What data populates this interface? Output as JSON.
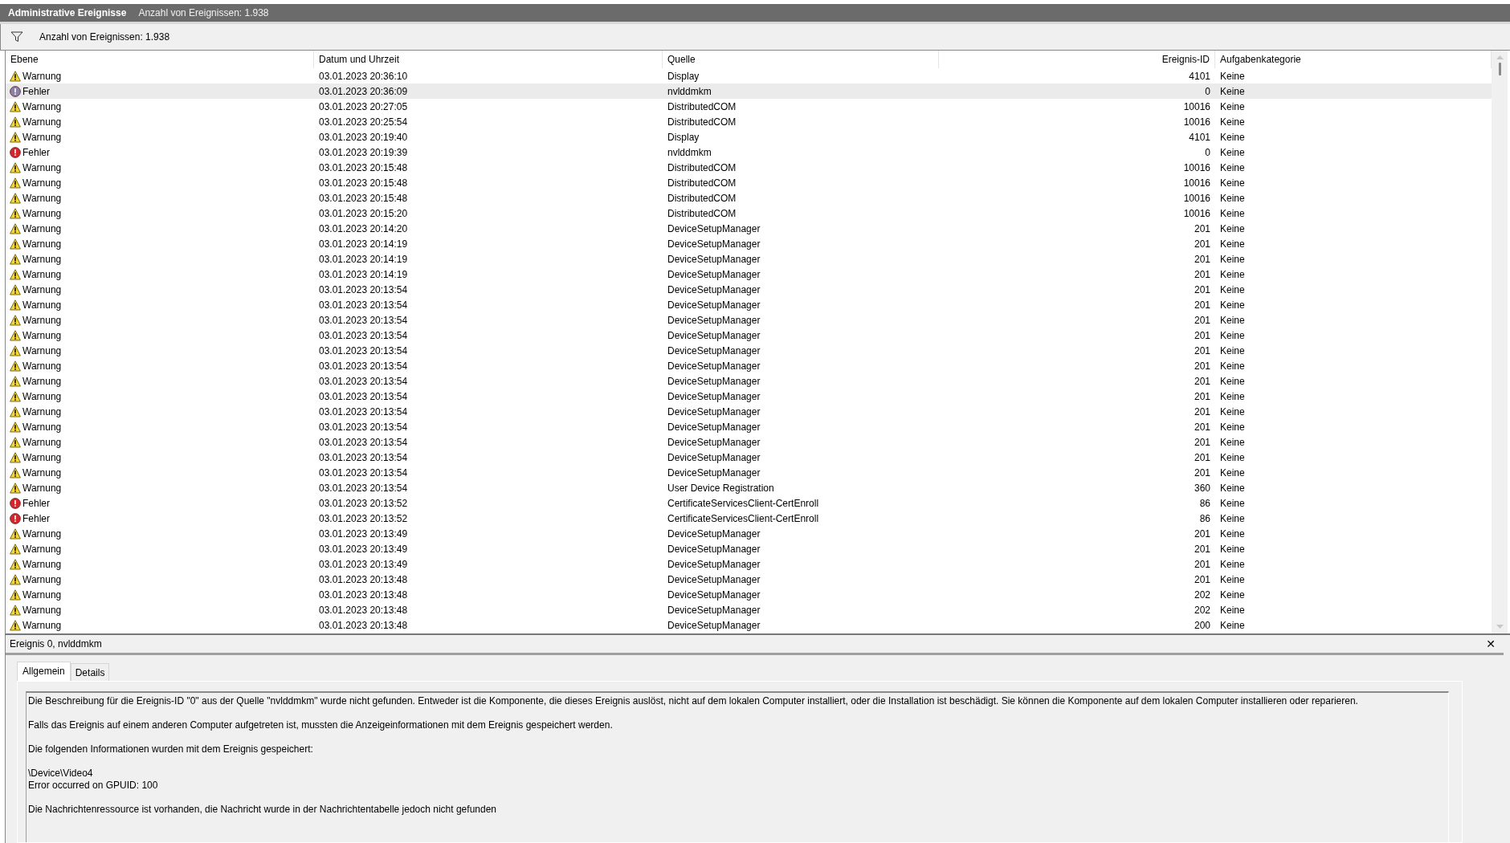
{
  "title_bar": {
    "title": "Administrative Ereignisse",
    "count": "Anzahl von Ereignissen: 1.938"
  },
  "filter_bar": {
    "text": "Anzahl von Ereignissen: 1.938"
  },
  "table": {
    "columns": [
      "Ebene",
      "Datum und Uhrzeit",
      "Quelle",
      "Ereignis-ID",
      "Aufgabenkategorie"
    ],
    "rows": [
      {
        "kind": "warning",
        "level": "Warnung",
        "datetime": "03.01.2023 20:36:10",
        "source": "Display",
        "event_id": "4101",
        "category": "Keine",
        "selected": false
      },
      {
        "kind": "error",
        "level": "Fehler",
        "datetime": "03.01.2023 20:36:09",
        "source": "nvlddmkm",
        "event_id": "0",
        "category": "Keine",
        "selected": true
      },
      {
        "kind": "warning",
        "level": "Warnung",
        "datetime": "03.01.2023 20:27:05",
        "source": "DistributedCOM",
        "event_id": "10016",
        "category": "Keine",
        "selected": false
      },
      {
        "kind": "warning",
        "level": "Warnung",
        "datetime": "03.01.2023 20:25:54",
        "source": "DistributedCOM",
        "event_id": "10016",
        "category": "Keine",
        "selected": false
      },
      {
        "kind": "warning",
        "level": "Warnung",
        "datetime": "03.01.2023 20:19:40",
        "source": "Display",
        "event_id": "4101",
        "category": "Keine",
        "selected": false
      },
      {
        "kind": "error",
        "level": "Fehler",
        "datetime": "03.01.2023 20:19:39",
        "source": "nvlddmkm",
        "event_id": "0",
        "category": "Keine",
        "selected": false
      },
      {
        "kind": "warning",
        "level": "Warnung",
        "datetime": "03.01.2023 20:15:48",
        "source": "DistributedCOM",
        "event_id": "10016",
        "category": "Keine",
        "selected": false
      },
      {
        "kind": "warning",
        "level": "Warnung",
        "datetime": "03.01.2023 20:15:48",
        "source": "DistributedCOM",
        "event_id": "10016",
        "category": "Keine",
        "selected": false
      },
      {
        "kind": "warning",
        "level": "Warnung",
        "datetime": "03.01.2023 20:15:48",
        "source": "DistributedCOM",
        "event_id": "10016",
        "category": "Keine",
        "selected": false
      },
      {
        "kind": "warning",
        "level": "Warnung",
        "datetime": "03.01.2023 20:15:20",
        "source": "DistributedCOM",
        "event_id": "10016",
        "category": "Keine",
        "selected": false
      },
      {
        "kind": "warning",
        "level": "Warnung",
        "datetime": "03.01.2023 20:14:20",
        "source": "DeviceSetupManager",
        "event_id": "201",
        "category": "Keine",
        "selected": false
      },
      {
        "kind": "warning",
        "level": "Warnung",
        "datetime": "03.01.2023 20:14:19",
        "source": "DeviceSetupManager",
        "event_id": "201",
        "category": "Keine",
        "selected": false
      },
      {
        "kind": "warning",
        "level": "Warnung",
        "datetime": "03.01.2023 20:14:19",
        "source": "DeviceSetupManager",
        "event_id": "201",
        "category": "Keine",
        "selected": false
      },
      {
        "kind": "warning",
        "level": "Warnung",
        "datetime": "03.01.2023 20:14:19",
        "source": "DeviceSetupManager",
        "event_id": "201",
        "category": "Keine",
        "selected": false
      },
      {
        "kind": "warning",
        "level": "Warnung",
        "datetime": "03.01.2023 20:13:54",
        "source": "DeviceSetupManager",
        "event_id": "201",
        "category": "Keine",
        "selected": false
      },
      {
        "kind": "warning",
        "level": "Warnung",
        "datetime": "03.01.2023 20:13:54",
        "source": "DeviceSetupManager",
        "event_id": "201",
        "category": "Keine",
        "selected": false
      },
      {
        "kind": "warning",
        "level": "Warnung",
        "datetime": "03.01.2023 20:13:54",
        "source": "DeviceSetupManager",
        "event_id": "201",
        "category": "Keine",
        "selected": false
      },
      {
        "kind": "warning",
        "level": "Warnung",
        "datetime": "03.01.2023 20:13:54",
        "source": "DeviceSetupManager",
        "event_id": "201",
        "category": "Keine",
        "selected": false
      },
      {
        "kind": "warning",
        "level": "Warnung",
        "datetime": "03.01.2023 20:13:54",
        "source": "DeviceSetupManager",
        "event_id": "201",
        "category": "Keine",
        "selected": false
      },
      {
        "kind": "warning",
        "level": "Warnung",
        "datetime": "03.01.2023 20:13:54",
        "source": "DeviceSetupManager",
        "event_id": "201",
        "category": "Keine",
        "selected": false
      },
      {
        "kind": "warning",
        "level": "Warnung",
        "datetime": "03.01.2023 20:13:54",
        "source": "DeviceSetupManager",
        "event_id": "201",
        "category": "Keine",
        "selected": false
      },
      {
        "kind": "warning",
        "level": "Warnung",
        "datetime": "03.01.2023 20:13:54",
        "source": "DeviceSetupManager",
        "event_id": "201",
        "category": "Keine",
        "selected": false
      },
      {
        "kind": "warning",
        "level": "Warnung",
        "datetime": "03.01.2023 20:13:54",
        "source": "DeviceSetupManager",
        "event_id": "201",
        "category": "Keine",
        "selected": false
      },
      {
        "kind": "warning",
        "level": "Warnung",
        "datetime": "03.01.2023 20:13:54",
        "source": "DeviceSetupManager",
        "event_id": "201",
        "category": "Keine",
        "selected": false
      },
      {
        "kind": "warning",
        "level": "Warnung",
        "datetime": "03.01.2023 20:13:54",
        "source": "DeviceSetupManager",
        "event_id": "201",
        "category": "Keine",
        "selected": false
      },
      {
        "kind": "warning",
        "level": "Warnung",
        "datetime": "03.01.2023 20:13:54",
        "source": "DeviceSetupManager",
        "event_id": "201",
        "category": "Keine",
        "selected": false
      },
      {
        "kind": "warning",
        "level": "Warnung",
        "datetime": "03.01.2023 20:13:54",
        "source": "DeviceSetupManager",
        "event_id": "201",
        "category": "Keine",
        "selected": false
      },
      {
        "kind": "warning",
        "level": "Warnung",
        "datetime": "03.01.2023 20:13:54",
        "source": "User Device Registration",
        "event_id": "360",
        "category": "Keine",
        "selected": false
      },
      {
        "kind": "error",
        "level": "Fehler",
        "datetime": "03.01.2023 20:13:52",
        "source": "CertificateServicesClient-CertEnroll",
        "event_id": "86",
        "category": "Keine",
        "selected": false
      },
      {
        "kind": "error",
        "level": "Fehler",
        "datetime": "03.01.2023 20:13:52",
        "source": "CertificateServicesClient-CertEnroll",
        "event_id": "86",
        "category": "Keine",
        "selected": false
      },
      {
        "kind": "warning",
        "level": "Warnung",
        "datetime": "03.01.2023 20:13:49",
        "source": "DeviceSetupManager",
        "event_id": "201",
        "category": "Keine",
        "selected": false
      },
      {
        "kind": "warning",
        "level": "Warnung",
        "datetime": "03.01.2023 20:13:49",
        "source": "DeviceSetupManager",
        "event_id": "201",
        "category": "Keine",
        "selected": false
      },
      {
        "kind": "warning",
        "level": "Warnung",
        "datetime": "03.01.2023 20:13:49",
        "source": "DeviceSetupManager",
        "event_id": "201",
        "category": "Keine",
        "selected": false
      },
      {
        "kind": "warning",
        "level": "Warnung",
        "datetime": "03.01.2023 20:13:48",
        "source": "DeviceSetupManager",
        "event_id": "201",
        "category": "Keine",
        "selected": false
      },
      {
        "kind": "warning",
        "level": "Warnung",
        "datetime": "03.01.2023 20:13:48",
        "source": "DeviceSetupManager",
        "event_id": "202",
        "category": "Keine",
        "selected": false
      },
      {
        "kind": "warning",
        "level": "Warnung",
        "datetime": "03.01.2023 20:13:48",
        "source": "DeviceSetupManager",
        "event_id": "202",
        "category": "Keine",
        "selected": false
      },
      {
        "kind": "warning",
        "level": "Warnung",
        "datetime": "03.01.2023 20:13:48",
        "source": "DeviceSetupManager",
        "event_id": "200",
        "category": "Keine",
        "selected": false
      }
    ]
  },
  "detail_panel": {
    "title": "Ereignis 0, nvlddmkm",
    "close": "✕",
    "tabs": [
      {
        "label": "Allgemein",
        "selected": true
      },
      {
        "label": "Details",
        "selected": false
      }
    ],
    "description": [
      [
        "Die Beschreibung für die Ereignis-ID \"0\" aus der Quelle \"nvlddmkm\" wurde nicht gefunden. Entweder ist die Komponente, die dieses Ereignis auslöst, nicht auf dem lokalen Computer installiert, oder die Installation ist beschädigt. Sie können die Komponente auf dem lokalen Computer installieren oder reparieren."
      ],
      [
        "Falls das Ereignis auf einem anderen Computer aufgetreten ist, mussten die Anzeigeinformationen mit dem Ereignis gespeichert werden."
      ],
      [
        "Die folgenden Informationen wurden mit dem Ereignis gespeichert:"
      ],
      [
        "\\Device\\Video4",
        "Error occurred on GPUID: 100"
      ],
      [
        "Die Nachrichtenressource ist vorhanden, die Nachricht wurde in der Nachrichtentabelle jedoch nicht gefunden"
      ]
    ]
  }
}
